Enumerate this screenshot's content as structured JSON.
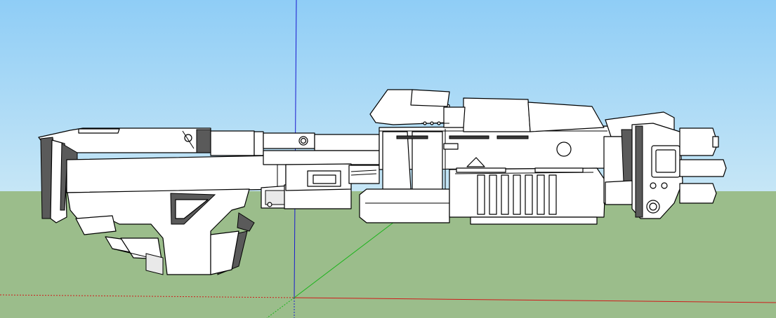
{
  "scene": {
    "sky_top_color": "#8fcdf6",
    "sky_bottom_color": "#c6e6f6",
    "ground_color": "#9bbd8b",
    "axes": {
      "blue_axis_color": "#1a1ad0",
      "red_axis_color": "#d01a1a",
      "green_axis_color": "#1ab41a"
    },
    "model": {
      "name": "rifle-model",
      "face_color": "#ffffff",
      "shadow_color": "#5a5a5a"
    }
  }
}
